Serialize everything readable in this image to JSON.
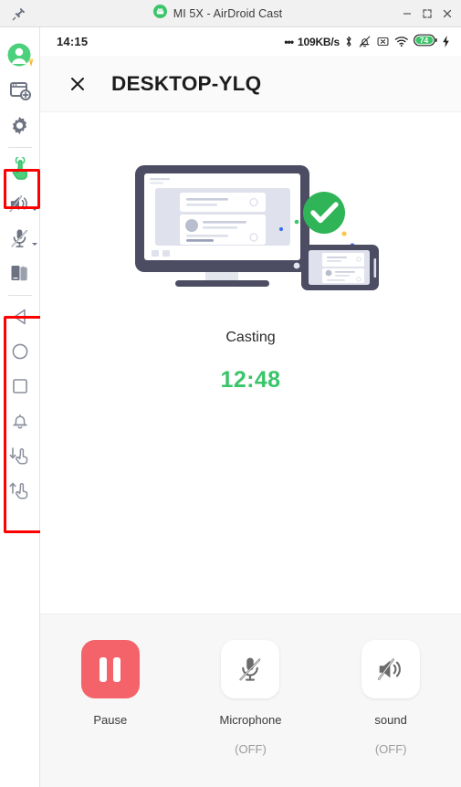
{
  "window": {
    "title": "MI 5X - AirDroid Cast",
    "app_icon": "android-robot-icon",
    "pin_label": "pin-window",
    "minimize_label": "–",
    "maximize_label": "maximize",
    "close_label": "×"
  },
  "sidebar": {
    "items": [
      {
        "name": "account-avatar",
        "label": "Account",
        "icon": "user-avatar-icon",
        "interactable": true
      },
      {
        "name": "new-connection",
        "label": "New connection",
        "icon": "add-window-icon",
        "interactable": true
      },
      {
        "name": "settings",
        "label": "Settings",
        "icon": "gear-icon",
        "interactable": true
      },
      {
        "name": "remote-control",
        "label": "Remote control",
        "icon": "touch-hand-icon",
        "interactable": true
      },
      {
        "name": "device-sound",
        "label": "Device sound",
        "icon": "speaker-muted-icon",
        "interactable": true
      },
      {
        "name": "microphone",
        "label": "Microphone",
        "icon": "microphone-muted-icon",
        "interactable": true
      },
      {
        "name": "file-transfer",
        "label": "File transfer",
        "icon": "file-transfer-icon",
        "interactable": true
      },
      {
        "name": "nav-back",
        "label": "Back",
        "icon": "back-triangle-icon",
        "interactable": true
      },
      {
        "name": "nav-home",
        "label": "Home",
        "icon": "home-circle-icon",
        "interactable": true
      },
      {
        "name": "nav-recents",
        "label": "Recents",
        "icon": "recents-square-icon",
        "interactable": true
      },
      {
        "name": "notifications",
        "label": "Notifications",
        "icon": "bell-icon",
        "interactable": true
      },
      {
        "name": "download-to-device",
        "label": "Download",
        "icon": "hand-down-arrow-icon",
        "interactable": true
      },
      {
        "name": "upload-from-device",
        "label": "Upload",
        "icon": "hand-up-arrow-icon",
        "interactable": true
      }
    ],
    "highlights": [
      {
        "name": "highlight-remote-control",
        "color": "#ff0000"
      },
      {
        "name": "highlight-navigation-group",
        "color": "#ff0000"
      }
    ]
  },
  "phone": {
    "statusbar": {
      "time": "14:15",
      "network_speed": "109KB/s",
      "speed_prefix": "•••",
      "icons": [
        "bluetooth-icon",
        "bell-muted-icon",
        "sim-x-icon",
        "wifi-icon"
      ],
      "battery_level": "74",
      "charging": "charging-bolt-icon"
    },
    "header": {
      "close_icon": "close-x-icon",
      "device_name": "DESKTOP-YLQ"
    },
    "content": {
      "illustration": "monitor-phone-casting-illustration",
      "status_text": "Casting",
      "timer": "12:48",
      "timer_color": "#3ac569",
      "check_color": "#2fb457"
    },
    "controls": [
      {
        "name": "pause-button",
        "icon": "pause-icon",
        "label": "Pause",
        "state": "",
        "accent": "#f4636a",
        "style": "filled"
      },
      {
        "name": "microphone-button",
        "icon": "microphone-muted-icon",
        "label": "Microphone",
        "state": "(OFF)",
        "accent": "#ffffff",
        "style": "plain"
      },
      {
        "name": "sound-button",
        "icon": "speaker-muted-icon",
        "label": "sound",
        "state": "(OFF)",
        "accent": "#ffffff",
        "style": "plain"
      }
    ]
  }
}
